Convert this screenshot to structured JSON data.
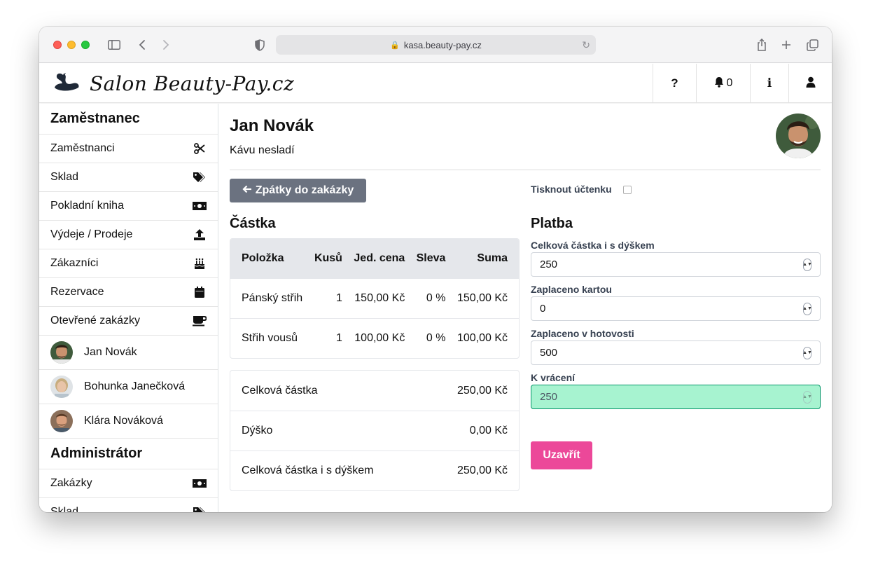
{
  "browser": {
    "url": "kasa.beauty-pay.cz"
  },
  "header": {
    "brand": "Salon Beauty-Pay.cz",
    "help_label": "?",
    "notifications_count": "0",
    "info_label": "i",
    "icons": [
      "swan-logo",
      "question-icon",
      "bell-icon",
      "info-icon",
      "user-icon"
    ]
  },
  "sidebar": {
    "employee_heading": "Zaměstnanec",
    "employee_items": [
      {
        "label": "Zaměstnanci",
        "icon": "scissors-icon"
      },
      {
        "label": "Sklad",
        "icon": "tags-icon"
      },
      {
        "label": "Pokladní kniha",
        "icon": "money-bill-icon"
      },
      {
        "label": "Výdeje / Prodeje",
        "icon": "upload-icon"
      },
      {
        "label": "Zákazníci",
        "icon": "birthday-cake-icon"
      },
      {
        "label": "Rezervace",
        "icon": "calendar-icon"
      },
      {
        "label": "Otevřené zakázky",
        "icon": "coffee-icon"
      }
    ],
    "people": [
      {
        "name": "Jan Novák"
      },
      {
        "name": "Bohunka Janečková"
      },
      {
        "name": "Klára Nováková"
      }
    ],
    "admin_heading": "Administrátor",
    "admin_items": [
      {
        "label": "Zakázky",
        "icon": "money-bill-icon"
      },
      {
        "label": "Sklad",
        "icon": "tags-icon"
      }
    ]
  },
  "customer": {
    "name": "Jan Novák",
    "note": "Kávu nesladí"
  },
  "back_button_label": "Zpátky do zakázky",
  "amount": {
    "title": "Částka",
    "columns": [
      "Položka",
      "Kusů",
      "Jed. cena",
      "Sleva",
      "Suma"
    ],
    "rows": [
      [
        "Pánský střih",
        "1",
        "150,00 Kč",
        "0 %",
        "150,00 Kč"
      ],
      [
        "Střih vousů",
        "1",
        "100,00 Kč",
        "0 %",
        "100,00 Kč"
      ]
    ],
    "summary": [
      {
        "label": "Celková částka",
        "value": "250,00 Kč"
      },
      {
        "label": "Dýško",
        "value": "0,00 Kč"
      },
      {
        "label": "Celková částka i s dýškem",
        "value": "250,00 Kč"
      }
    ]
  },
  "print_receipt_label": "Tisknout účtenku",
  "payment": {
    "title": "Platba",
    "fields": [
      {
        "label": "Celková částka i s dýškem",
        "value": "250"
      },
      {
        "label": "Zaplaceno kartou",
        "value": "0"
      },
      {
        "label": "Zaplaceno v hotovosti",
        "value": "500"
      },
      {
        "label": "K vrácení",
        "value": "250"
      }
    ],
    "close_label": "Uzavřít"
  },
  "colors": {
    "accent": "#ec4899",
    "back_button": "#6b7280",
    "change_field": "#a7f3d0"
  }
}
